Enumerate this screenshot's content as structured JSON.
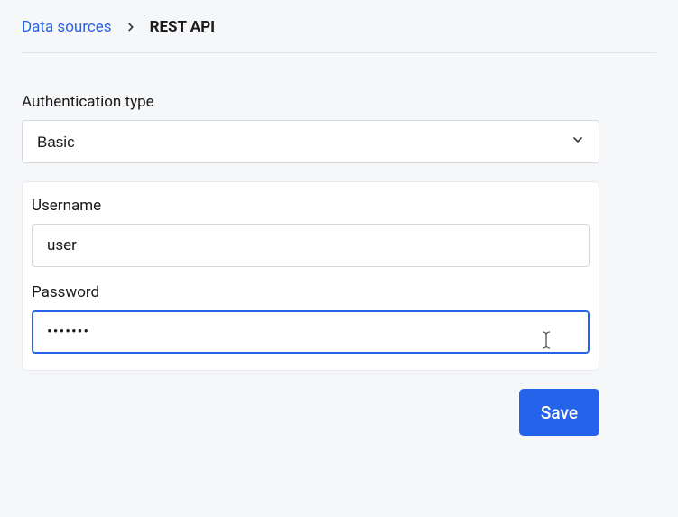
{
  "breadcrumb": {
    "parent": "Data sources",
    "current": "REST API"
  },
  "auth": {
    "type_label": "Authentication type",
    "type_value": "Basic",
    "username_label": "Username",
    "username_value": "user",
    "password_label": "Password",
    "password_value": "•••••••"
  },
  "actions": {
    "save_label": "Save"
  }
}
